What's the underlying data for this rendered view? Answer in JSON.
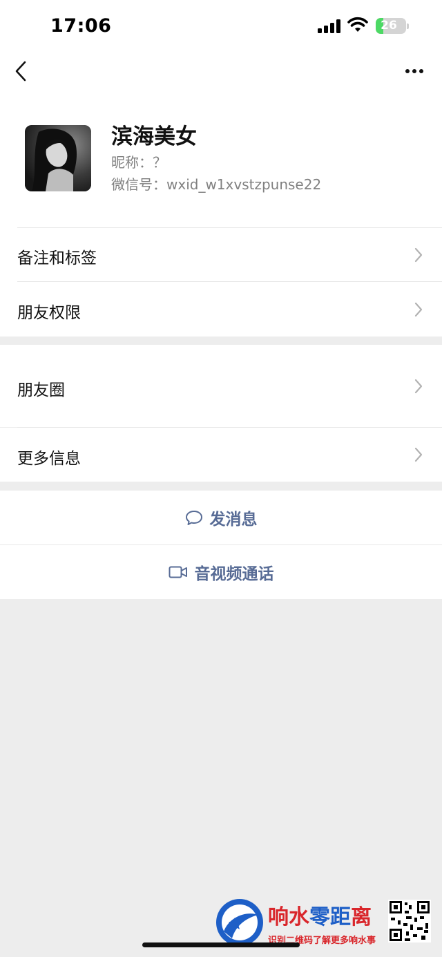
{
  "status_bar": {
    "time": "17:06",
    "battery": "26",
    "battery_level": 0.26,
    "icons": [
      "signal-icon",
      "wifi-icon",
      "battery-icon"
    ]
  },
  "nav": {
    "back_icon": "back-chevron-icon",
    "more_icon": "more-dots-icon"
  },
  "profile": {
    "name": "滨海美女",
    "nickname_label": "昵称：",
    "nickname": "？",
    "wxid_label": "微信号：",
    "wxid": "wxid_w1xvstzpunse22"
  },
  "section1": [
    {
      "label": "备注和标签"
    },
    {
      "label": "朋友权限"
    }
  ],
  "section2": [
    {
      "label": "朋友圈"
    },
    {
      "label": "更多信息"
    }
  ],
  "actions": {
    "message": {
      "label": "发消息",
      "icon": "chat-bubble-icon"
    },
    "call": {
      "label": "音视频通话",
      "icon": "video-camera-icon"
    }
  },
  "colors": {
    "link_blue": "#576b95",
    "background": "#ededed",
    "battery_green": "#4cd964"
  },
  "watermark": {
    "title": "响水零距离",
    "subtitle": "识别二维码了解更多响水事"
  }
}
